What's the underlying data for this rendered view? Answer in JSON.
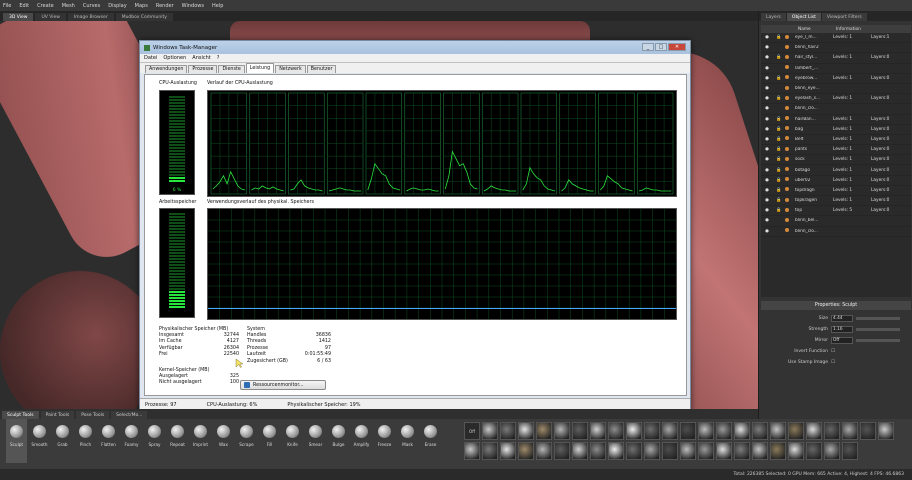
{
  "menu": [
    "File",
    "Edit",
    "Create",
    "Mesh",
    "Curves",
    "Display",
    "Maps",
    "Render",
    "Windows",
    "Help"
  ],
  "viewport_tabs": [
    {
      "label": "3D View",
      "active": true
    },
    {
      "label": "UV View",
      "active": false
    },
    {
      "label": "Image Browser",
      "active": false
    },
    {
      "label": "Mudbox Community",
      "active": false
    }
  ],
  "taskmanager": {
    "title": "Windows Task-Manager",
    "menu": [
      "Datei",
      "Optionen",
      "Ansicht",
      "?"
    ],
    "tabs": [
      "Anwendungen",
      "Prozesse",
      "Dienste",
      "Leistung",
      "Netzwerk",
      "Benutzer"
    ],
    "active_tab": "Leistung",
    "cpu_label": "CPU-Auslastung",
    "cpu_value": "6 %",
    "cpu_history_label": "Verlauf der CPU-Auslastung",
    "mem_label": "Arbeitsspeicher",
    "mem_history_label": "Verwendungsverlauf des physikal. Speichers",
    "physical": {
      "title": "Physikalischer Speicher (MB)",
      "rows": [
        [
          "Insgesamt",
          "32744"
        ],
        [
          "Im Cache",
          "4127"
        ],
        [
          "Verfügbar",
          "26304"
        ],
        [
          "Frei",
          "22540"
        ]
      ]
    },
    "kernel": {
      "title": "Kernel-Speicher (MB)",
      "rows": [
        [
          "Ausgelagert",
          "325"
        ],
        [
          "Nicht ausgelagert",
          "100"
        ]
      ]
    },
    "system": {
      "title": "System",
      "rows": [
        [
          "Handles",
          "36836"
        ],
        [
          "Threads",
          "1412"
        ],
        [
          "Prozesse",
          "97"
        ],
        [
          "Laufzeit",
          "0:01:55:49"
        ],
        [
          "Zugesichert (GB)",
          "6 / 63"
        ]
      ]
    },
    "resmon_button": "Ressourcenmonitor...",
    "status": [
      "Prozesse: 97",
      "CPU-Auslastung: 6%",
      "Physikalischer Speicher: 19%"
    ],
    "cpu_cores": [
      [
        0.05,
        0.08,
        0.12,
        0.18,
        0.1,
        0.22,
        0.15,
        0.08,
        0.05,
        0.04
      ],
      [
        0.04,
        0.06,
        0.05,
        0.08,
        0.06,
        0.05,
        0.07,
        0.05,
        0.04,
        0.03
      ],
      [
        0.04,
        0.05,
        0.1,
        0.14,
        0.08,
        0.06,
        0.05,
        0.04,
        0.04,
        0.03
      ],
      [
        0.03,
        0.04,
        0.05,
        0.06,
        0.05,
        0.04,
        0.04,
        0.03,
        0.03,
        0.03
      ],
      [
        0.04,
        0.15,
        0.3,
        0.25,
        0.2,
        0.18,
        0.1,
        0.06,
        0.05,
        0.04
      ],
      [
        0.03,
        0.05,
        0.06,
        0.05,
        0.04,
        0.04,
        0.05,
        0.04,
        0.03,
        0.03
      ],
      [
        0.05,
        0.18,
        0.42,
        0.35,
        0.28,
        0.3,
        0.22,
        0.1,
        0.06,
        0.05
      ],
      [
        0.03,
        0.05,
        0.08,
        0.06,
        0.05,
        0.04,
        0.04,
        0.03,
        0.03,
        0.03
      ],
      [
        0.04,
        0.1,
        0.26,
        0.2,
        0.16,
        0.14,
        0.08,
        0.05,
        0.04,
        0.03
      ],
      [
        0.03,
        0.06,
        0.14,
        0.1,
        0.08,
        0.06,
        0.05,
        0.04,
        0.03,
        0.03
      ],
      [
        0.04,
        0.08,
        0.18,
        0.15,
        0.12,
        0.1,
        0.06,
        0.05,
        0.04,
        0.03
      ],
      [
        0.03,
        0.04,
        0.06,
        0.05,
        0.04,
        0.04,
        0.03,
        0.03,
        0.03,
        0.03
      ]
    ],
    "memory_usage": 0.19
  },
  "right_panel": {
    "tabs": [
      {
        "label": "Layers",
        "active": false
      },
      {
        "label": "Object List",
        "active": true
      },
      {
        "label": "Viewport Filters",
        "active": false
      }
    ],
    "headers": [
      "Name",
      "Information"
    ],
    "objects": [
      {
        "name": "eye_l_m...",
        "level": "Levels: 1",
        "layers": "Layers:1"
      },
      {
        "name": "blinn_hair2",
        "level": "",
        "layers": ""
      },
      {
        "name": "hair_styl...",
        "level": "Levels: 1",
        "layers": "Layers:0"
      },
      {
        "name": "lambert_...",
        "level": "",
        "layers": ""
      },
      {
        "name": "eyebrow...",
        "level": "Levels: 1",
        "layers": "Layers:0"
      },
      {
        "name": "blinn_eye...",
        "level": "",
        "layers": ""
      },
      {
        "name": "eyelash_s...",
        "level": "Levels: 1",
        "layers": "Layers:0"
      },
      {
        "name": "blinn_clo...",
        "level": "",
        "layers": ""
      },
      {
        "name": "hairBan...",
        "level": "Levels: 1",
        "layers": "Layers:0"
      },
      {
        "name": "bag",
        "level": "Levels: 1",
        "layers": "Layers:0"
      },
      {
        "name": "Belt",
        "level": "Levels: 1",
        "layers": "Layers:0"
      },
      {
        "name": "pants",
        "level": "Levels: 1",
        "layers": "Layers:0"
      },
      {
        "name": "sock",
        "level": "Levels: 1",
        "layers": "Layers:0"
      },
      {
        "name": "botago",
        "level": "Levels: 1",
        "layers": "Layers:0"
      },
      {
        "name": "uber02",
        "level": "Levels: 1",
        "layers": "Layers:0"
      },
      {
        "name": "topdragn",
        "level": "Levels: 1",
        "layers": "Layers:0"
      },
      {
        "name": "topkragen",
        "level": "Levels: 1",
        "layers": "Layers:0"
      },
      {
        "name": "top",
        "level": "Levels: 5",
        "layers": "Layers:0"
      },
      {
        "name": "blinn_bel...",
        "level": "",
        "layers": ""
      },
      {
        "name": "blinn_clo...",
        "level": "",
        "layers": ""
      }
    ],
    "properties_title": "Properties: Sculpt",
    "props": [
      {
        "label": "Size",
        "value": "4.44"
      },
      {
        "label": "Strength",
        "value": "1.16"
      },
      {
        "label": "Mirror",
        "value": "Off"
      },
      {
        "label": "Invert Function",
        "value": ""
      },
      {
        "label": "Use Stamp Image",
        "value": ""
      }
    ]
  },
  "shelf_tabs": [
    {
      "label": "Sculpt Tools",
      "active": true
    },
    {
      "label": "Paint Tools",
      "active": false
    },
    {
      "label": "Pose Tools",
      "active": false
    },
    {
      "label": "Select/Mo...",
      "active": false
    }
  ],
  "tools": [
    "Sculpt",
    "Smooth",
    "Grab",
    "Pinch",
    "Flatten",
    "Foamy",
    "Spray",
    "Repeat",
    "Imprint",
    "Wax",
    "Scrape",
    "Fill",
    "Knife",
    "Smear",
    "Bulge",
    "Amplify",
    "Freeze",
    "Mask",
    "Erase"
  ],
  "status_bar": "Total: 226385  Selected: 0  GPU Mem: 665  Active: 4, Highest: 4  FPS: 46.6863"
}
